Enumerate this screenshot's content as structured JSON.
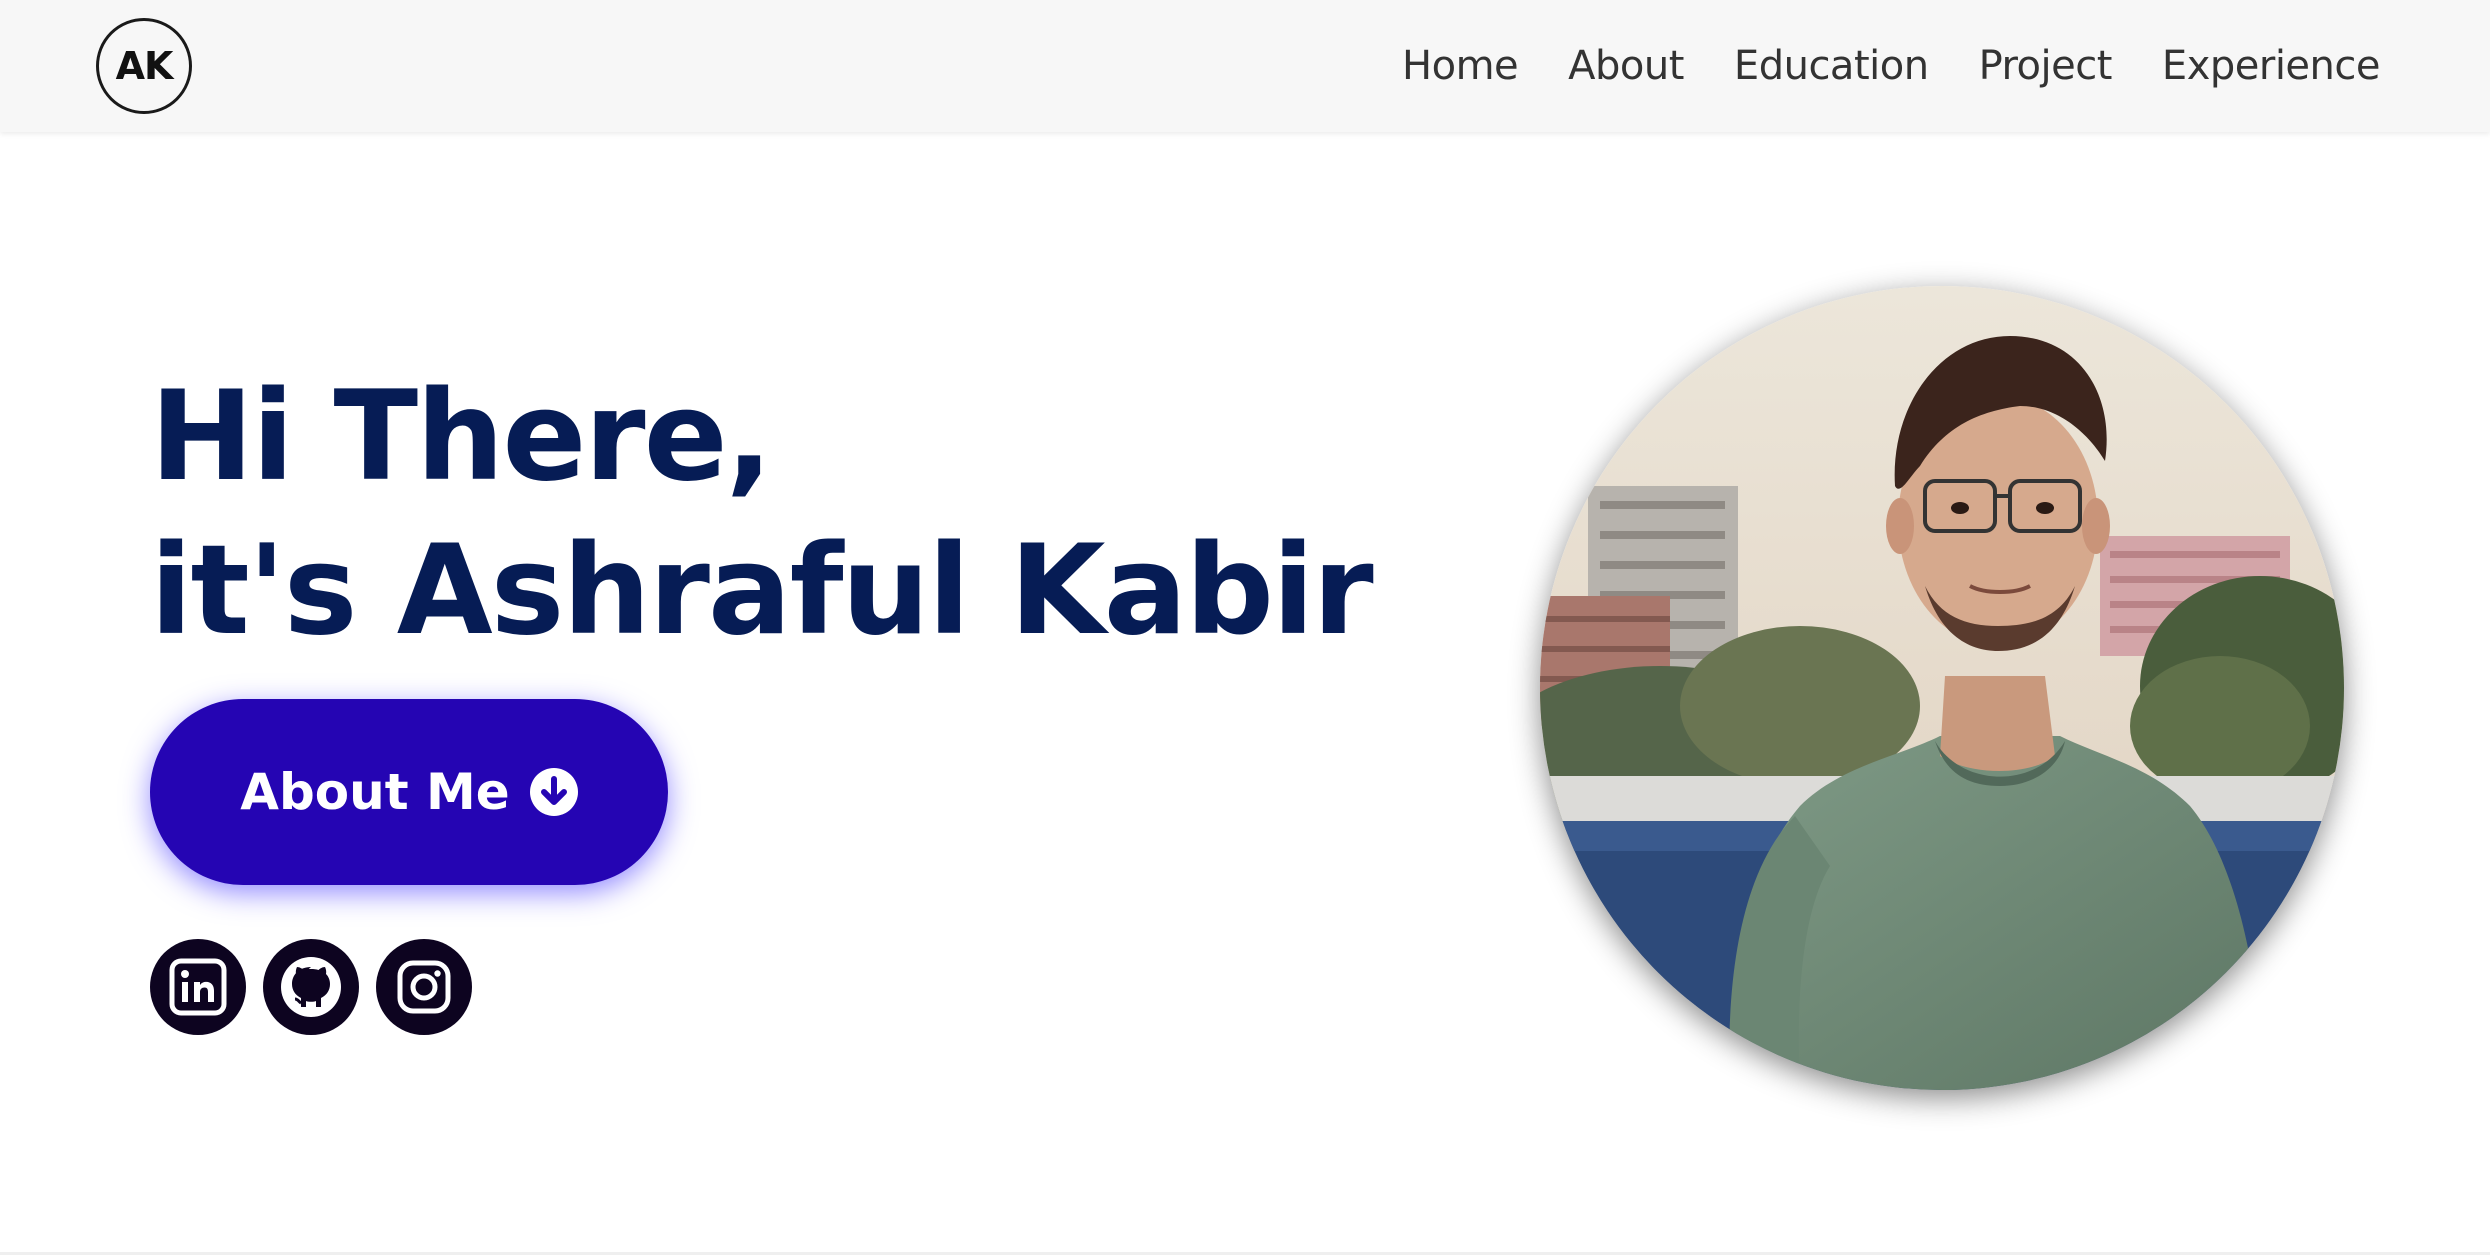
{
  "navbar": {
    "logo_text": "AK",
    "links": [
      {
        "label": "Home"
      },
      {
        "label": "About"
      },
      {
        "label": "Education"
      },
      {
        "label": "Project"
      },
      {
        "label": "Experience"
      }
    ]
  },
  "hero": {
    "greeting_line1": "Hi There,",
    "greeting_line2": "it's Ashraful Kabir",
    "about_button_label": "About Me",
    "about_button_icon": "arrow-down-circle-icon"
  },
  "socials": [
    {
      "name": "linkedin-icon"
    },
    {
      "name": "github-icon"
    },
    {
      "name": "instagram-icon"
    }
  ],
  "colors": {
    "heading": "#061c55",
    "button_bg": "#2505b3",
    "social_bg": "#0d0420",
    "navbar_bg": "#f7f7f7"
  }
}
